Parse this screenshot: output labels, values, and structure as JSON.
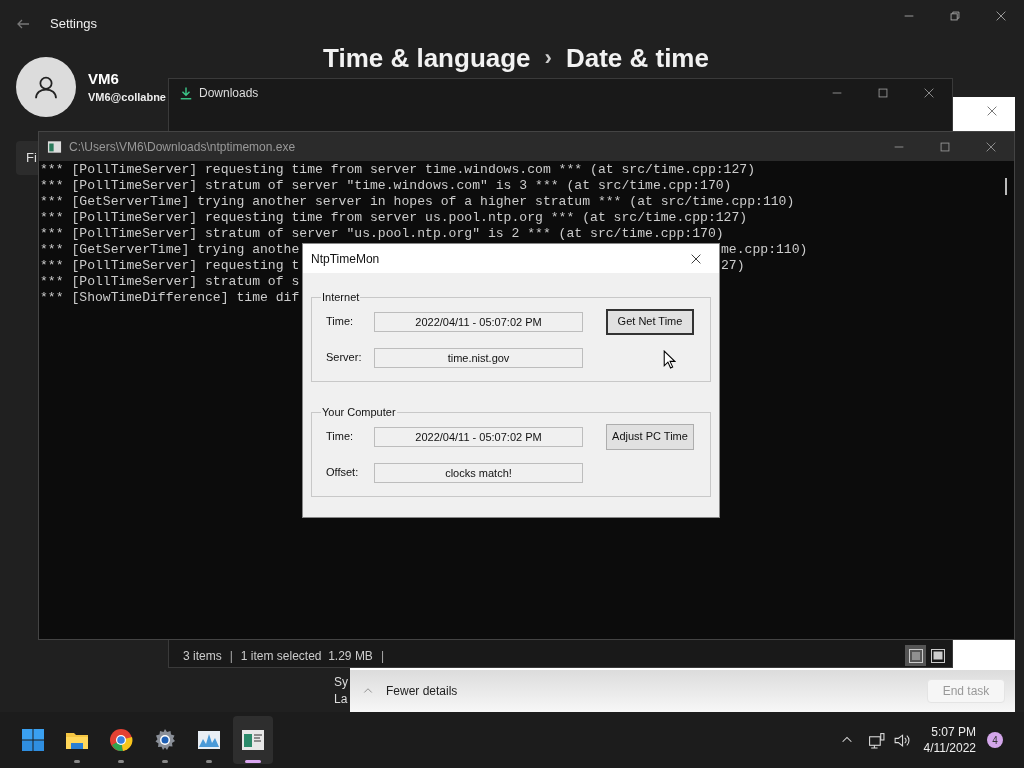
{
  "settings": {
    "title": "Settings",
    "user": {
      "name": "VM6",
      "email": "VM6@collabne"
    },
    "breadcrumb": {
      "parent": "Time & language",
      "separator": "›",
      "current": "Date & time"
    },
    "sidebar_text": "Fi",
    "content_lines": [
      "Sy",
      "La"
    ]
  },
  "task_manager": {
    "details_toggle": "Fewer details",
    "end_task": {
      "label": "End task",
      "disabled": true
    }
  },
  "downloads": {
    "title": "Downloads",
    "status": [
      "3 items",
      "1 item selected  1.29 MB"
    ],
    "status_separator": "|",
    "views": [
      {
        "kind": "details",
        "selected": true
      },
      {
        "kind": "tiles",
        "selected": false
      }
    ]
  },
  "console": {
    "title": "C:\\Users\\VM6\\Downloads\\ntptimemon.exe",
    "lines": [
      {
        "text": "*** [PollTimeServer] requesting time from server time.windows.com *** (at src/time.cpp:127)"
      },
      {
        "text": "*** [PollTimeServer] stratum of server \"time.windows.com\" is 3 *** (at src/time.cpp:170)"
      },
      {
        "text": "*** [GetServerTime] trying another server in hopes of a higher stratum *** (at src/time.cpp:110)"
      },
      {
        "text": "*** [PollTimeServer] requesting time from server us.pool.ntp.org *** (at src/time.cpp:127)"
      },
      {
        "text": "*** [PollTimeServer] stratum of server \"us.pool.ntp.org\" is 2 *** (at src/time.cpp:170)"
      },
      {
        "text": "*** [GetServerTime] trying anothe",
        "text_right": "me.cpp:110)"
      },
      {
        "text": "*** [PollTimeServer] requesting t",
        "text_right": "27)"
      },
      {
        "text": "*** [PollTimeServer] stratum of s"
      },
      {
        "text": "*** [ShowTimeDifference] time dif"
      }
    ]
  },
  "dialog": {
    "title": "NtpTimeMon",
    "groups": [
      {
        "title": "Internet",
        "rows": [
          {
            "label": "Time:",
            "value": "2022/04/11 - 05:07:02 PM",
            "button": {
              "label": "Get Net Time",
              "default": true
            }
          },
          {
            "label": "Server:",
            "value": "time.nist.gov"
          }
        ]
      },
      {
        "title": "Your Computer",
        "rows": [
          {
            "label": "Time:",
            "value": "2022/04/11 - 05:07:02 PM",
            "button": {
              "label": "Adjust PC Time",
              "default": false
            }
          },
          {
            "label": "Offset:",
            "value": "clocks match!"
          }
        ]
      }
    ]
  },
  "taskbar": {
    "apps": [
      {
        "kind": "start",
        "running": false,
        "selected": false
      },
      {
        "kind": "folder",
        "running": true,
        "selected": false
      },
      {
        "kind": "browser",
        "running": true,
        "selected": false
      },
      {
        "kind": "gear",
        "running": true,
        "selected": false
      },
      {
        "kind": "chart",
        "running": true,
        "selected": false
      },
      {
        "kind": "console",
        "running": true,
        "selected": true
      }
    ],
    "time": "5:07 PM",
    "date": "4/11/2022",
    "notification_count": "4"
  }
}
